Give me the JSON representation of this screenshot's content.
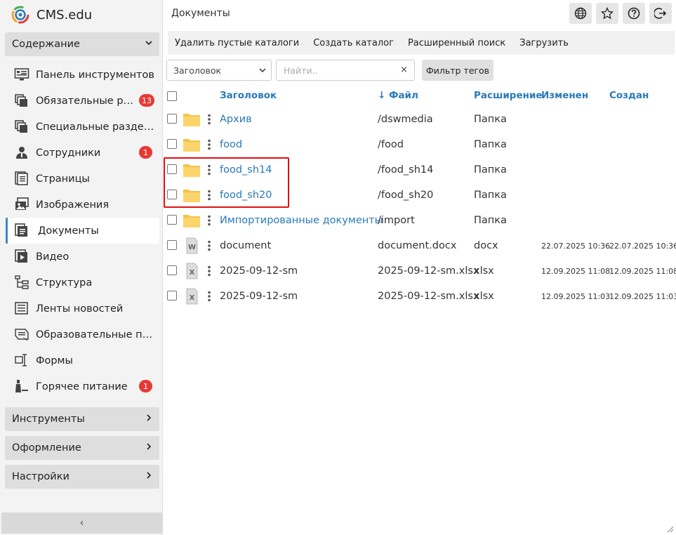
{
  "app": {
    "name": "CMS.edu"
  },
  "sidebar": {
    "content_section": "Содержание",
    "items": [
      {
        "label": "Панель инструментов",
        "icon": "dashboard-icon",
        "badge": ""
      },
      {
        "label": "Обязательные разделы",
        "icon": "layers-icon",
        "badge": "13"
      },
      {
        "label": "Специальные разделы",
        "icon": "layers-icon",
        "badge": ""
      },
      {
        "label": "Сотрудники",
        "icon": "user-icon",
        "badge": "1"
      },
      {
        "label": "Страницы",
        "icon": "pages-icon",
        "badge": ""
      },
      {
        "label": "Изображения",
        "icon": "images-icon",
        "badge": ""
      },
      {
        "label": "Документы",
        "icon": "documents-icon",
        "badge": ""
      },
      {
        "label": "Видео",
        "icon": "video-icon",
        "badge": ""
      },
      {
        "label": "Структура",
        "icon": "structure-icon",
        "badge": ""
      },
      {
        "label": "Ленты новостей",
        "icon": "news-icon",
        "badge": ""
      },
      {
        "label": "Образовательные программы",
        "icon": "education-icon",
        "badge": ""
      },
      {
        "label": "Формы",
        "icon": "forms-icon",
        "badge": ""
      },
      {
        "label": "Горячее питание",
        "icon": "food-icon",
        "badge": "1"
      }
    ],
    "sections": [
      {
        "label": "Инструменты"
      },
      {
        "label": "Оформление"
      },
      {
        "label": "Настройки"
      }
    ],
    "collapse_label": "‹"
  },
  "main": {
    "title": "Документы",
    "toolbar": [
      "Удалить пустые каталоги",
      "Создать каталог",
      "Расширенный поиск",
      "Загрузить"
    ],
    "filter": {
      "select_value": "Заголовок",
      "search_placeholder": "Найти..",
      "clear": "×",
      "tag_filter_label": "Фильтр тегов"
    },
    "table": {
      "headers": {
        "title": "Заголовок",
        "file": "↓ Файл",
        "ext": "Расширение",
        "modified": "Изменен",
        "created": "Создан"
      },
      "rows": [
        {
          "type": "folder",
          "title": "Архив",
          "file": "/dswmedia",
          "ext": "Папка",
          "modified": "",
          "created": ""
        },
        {
          "type": "folder",
          "title": "food",
          "file": "/food",
          "ext": "Папка",
          "modified": "",
          "created": ""
        },
        {
          "type": "folder",
          "title": "food_sh14",
          "file": "/food_sh14",
          "ext": "Папка",
          "modified": "",
          "created": ""
        },
        {
          "type": "folder",
          "title": "food_sh20",
          "file": "/food_sh20",
          "ext": "Папка",
          "modified": "",
          "created": ""
        },
        {
          "type": "folder",
          "title": "Импортированные документы",
          "file": "/import",
          "ext": "Папка",
          "modified": "",
          "created": ""
        },
        {
          "type": "word",
          "title": "document",
          "file": "document.docx",
          "ext": "docx",
          "modified": "22.07.2025 10:36",
          "created": "22.07.2025 10:36"
        },
        {
          "type": "excel",
          "title": "2025-09-12-sm",
          "file": "2025-09-12-sm.xlsx",
          "ext": "xlsx",
          "modified": "12.09.2025 11:08",
          "created": "12.09.2025 11:08"
        },
        {
          "type": "excel",
          "title": "2025-09-12-sm",
          "file": "2025-09-12-sm.xlsx",
          "ext": "xlsx",
          "modified": "12.09.2025 11:03",
          "created": "12.09.2025 11:03"
        }
      ]
    }
  },
  "colors": {
    "accent": "#2a7ab8",
    "badge": "#e53935",
    "folder": "#f5c24c",
    "highlight": "#e01010"
  }
}
